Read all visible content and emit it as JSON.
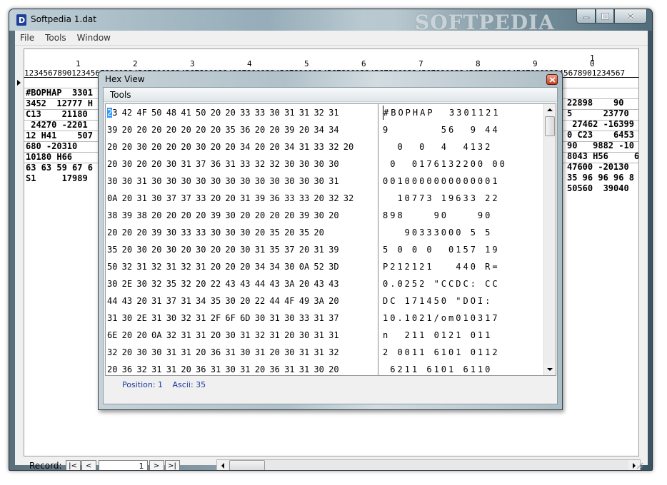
{
  "main_window": {
    "title": "Softpedia 1.dat",
    "watermark": "SOFTPEDIA",
    "menu": [
      "File",
      "Tools",
      "Window"
    ]
  },
  "ruler": {
    "tens": [
      "1",
      "2",
      "3",
      "4",
      "5",
      "6",
      "7",
      "8",
      "9",
      "0"
    ],
    "hundreds_marker": "1",
    "digits": "1234567890123456789012345678901234567890123456789012345678901234567890123456789012345678901234567890123456789012345678901234567"
  },
  "grid": {
    "rows": [
      {
        "left": "#BOPHAP  3301",
        "right": "22898    90"
      },
      {
        "left": "3452  12777 H",
        "right": "5      23770"
      },
      {
        "left": "C13    21180",
        "right": " 27462 -16399"
      },
      {
        "left": " 24270 -2201",
        "right": "0 C23    6453"
      },
      {
        "left": "12 H41    507",
        "right": "90   9882 -10"
      },
      {
        "left": "680 -20310",
        "right": "8043 H56     6"
      },
      {
        "left": "10180 H66",
        "right": "47600 -20130"
      },
      {
        "left": "63 63 59 67 6",
        "right": "35 96 96 96 8"
      },
      {
        "left": "S1     17989",
        "right": "50560  39040"
      }
    ]
  },
  "record_bar": {
    "label": "Record:",
    "value": "1",
    "first": "|<",
    "prev": "<",
    "next": ">",
    "last": ">|"
  },
  "hex_view": {
    "title": "Hex View",
    "menu": [
      "Tools"
    ],
    "hex_lines": [
      "23 42 4F 50 48 41 50 20 20 33 33 30 31 31 32 31",
      "39 20 20 20 20 20 20 20 35 36 20 20 39 20 34 34",
      "20 20 30 20 20 20 30 20 20 34 20 20 34 31 33 32 20",
      "20 30 20 20 30 31 37 36 31 33 32 32 30 30 30 30",
      "30 30 31 30 30 30 30 30 30 30 30 30 30 30 30 31",
      "0A 20 31 30 37 37 33 20 20 31 39 36 33 33 20 32 32",
      "38 39 38 20 20 20 20 39 30 20 20 20 20 39 30 20",
      "20 20 20 39 30 33 33 30 30 30 20 35 20 35 20",
      "35 20 30 20 30 20 30 20 20 30 31 35 37 20 31 39",
      "50 32 31 32 31 32 31 20 20 20 34 34 30 0A 52 3D",
      "30 2E 30 32 35 32 20 22 43 43 44 43 3A 20 43 43",
      "44 43 20 31 37 31 34 35 30 20 22 44 4F 49 3A 20",
      "31 30 2E 31 30 32 31 2F 6F 6D 30 31 30 33 31 37",
      "6E 20 20 0A 32 31 31 20 30 31 32 31 20 30 31 31",
      "32 20 30 30 31 31 20 36 31 30 31 20 30 31 31 32",
      "20 36 32 31 31 20 36 31 30 31 20 36 31 31 30 20"
    ],
    "ascii_lines": [
      "#BOPHAP  3301121",
      "9       56  9 44",
      "  0  0  4  4132 ",
      " 0  0176132200 00",
      "0010000000000001",
      "  10773 19633 22",
      "898    90    90 ",
      "   90333000 5 5",
      "5 0 0 0  0157 19",
      "P212121   440 R=",
      "0.0252 \"CCDC: CC",
      "DC 171450 \"DOI: ",
      "10.1021/om010317",
      "n  211 0121 011",
      "2 0011 6101 0112",
      " 6211 6101 6110 "
    ],
    "status": {
      "position_label": "Position: 1",
      "ascii_label": "Ascii: 35"
    }
  }
}
